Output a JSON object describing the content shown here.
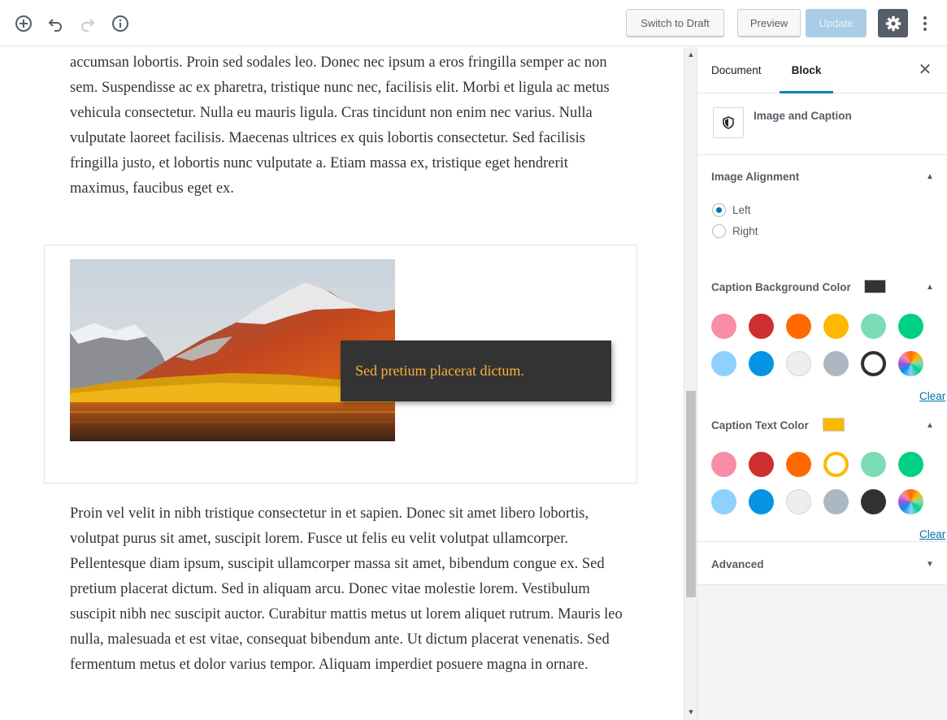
{
  "toolbar": {
    "switch_to_draft": "Switch to Draft",
    "preview": "Preview",
    "update": "Update",
    "icons": [
      "add-block-icon",
      "undo-icon",
      "redo-icon",
      "info-icon",
      "gear-icon",
      "more-vertical-icon"
    ]
  },
  "editor": {
    "paragraph_top": "accumsan lobortis. Proin sed sodales leo. Donec nec ipsum a eros fringilla semper ac non sem. Suspendisse ac ex pharetra, tristique nunc nec, facilisis elit. Morbi et ligula ac metus vehicula consectetur. Nulla eu mauris ligula. Cras tincidunt non enim nec varius. Nulla vulputate laoreet facilisis. Maecenas ultrices ex quis lobortis consectetur. Sed facilisis fringilla justo, et lobortis nunc vulputate a. Etiam massa ex, tristique eget hendrerit maximus, faucibus eget ex.",
    "caption": "Sed pretium placerat dictum.",
    "caption_background": "#333333",
    "caption_text_color": "#fbb03b",
    "paragraph_bottom": "Proin vel velit in nibh tristique consectetur in et sapien. Donec sit amet libero lobortis, volutpat purus sit amet, suscipit lorem. Fusce ut felis eu velit volutpat ullamcorper. Pellentesque diam ipsum, suscipit ullamcorper massa sit amet, bibendum congue ex. Sed pretium placerat dictum. Sed in aliquam arcu. Donec vitae molestie lorem. Vestibulum suscipit nibh nec suscipit auctor. Curabitur mattis metus ut lorem aliquet rutrum. Mauris leo nulla, malesuada et est vitae, consequat bibendum ante. Ut dictum placerat venenatis. Sed fermentum metus et dolor varius tempor. Aliquam imperdiet posuere magna in ornare."
  },
  "sidebar": {
    "tabs": [
      {
        "label": "Document",
        "active": false
      },
      {
        "label": "Block",
        "active": true
      }
    ],
    "block_title": "Image and Caption",
    "image_alignment": {
      "title": "Image Alignment",
      "options": [
        {
          "label": "Left",
          "checked": true
        },
        {
          "label": "Right",
          "checked": false
        }
      ]
    },
    "caption_bg": {
      "title": "Caption Background Color",
      "current": "#333333",
      "clear_label": "Clear",
      "selected_index": 10,
      "swatches": [
        "#f78da7",
        "#cf2e2e",
        "#ff6900",
        "#fcb900",
        "#7bdcb5",
        "#00d084",
        "#8ed1fc",
        "#0693e3",
        "#eeeeee",
        "#abb8c3",
        "#313131",
        "multicolor"
      ]
    },
    "caption_text": {
      "title": "Caption Text Color",
      "current": "#fbb03b",
      "clear_label": "Clear",
      "selected_index": 3,
      "swatches": [
        "#f78da7",
        "#cf2e2e",
        "#ff6900",
        "#fcb900",
        "#7bdcb5",
        "#00d084",
        "#8ed1fc",
        "#0693e3",
        "#eeeeee",
        "#abb8c3",
        "#313131",
        "multicolor"
      ]
    },
    "advanced": {
      "title": "Advanced"
    }
  },
  "colors": {
    "accent": "#0085ba",
    "link": "#0073aa"
  }
}
